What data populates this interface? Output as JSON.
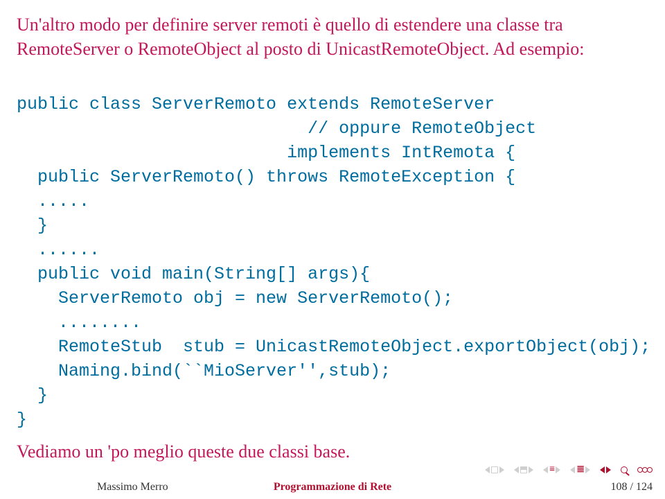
{
  "intro": "Un'altro modo per definire server remoti è quello di estendere una classe tra RemoteServer o RemoteObject al posto di UnicastRemoteObject. Ad esempio:",
  "code": {
    "l1": "public class ServerRemoto extends RemoteServer",
    "l2": "                            // oppure RemoteObject",
    "l3": "                          implements IntRemota {",
    "l4": "  public ServerRemoto() throws RemoteException {",
    "l5": "  .....",
    "l6": "  }",
    "l7": "  ......",
    "l8": "  public void main(String[] args){",
    "l9": "    ServerRemoto obj = new ServerRemoto();",
    "l10": "    ........",
    "l11": "    RemoteStub  stub = UnicastRemoteObject.exportObject(obj);",
    "l12": "    Naming.bind(``MioServer'',stub);",
    "l13": "  }",
    "l14": "}"
  },
  "outro": "Vediamo un 'po meglio queste due classi base.",
  "footer": {
    "author": "Massimo Merro",
    "title": "Programmazione di Rete",
    "pager": "108 / 124"
  }
}
